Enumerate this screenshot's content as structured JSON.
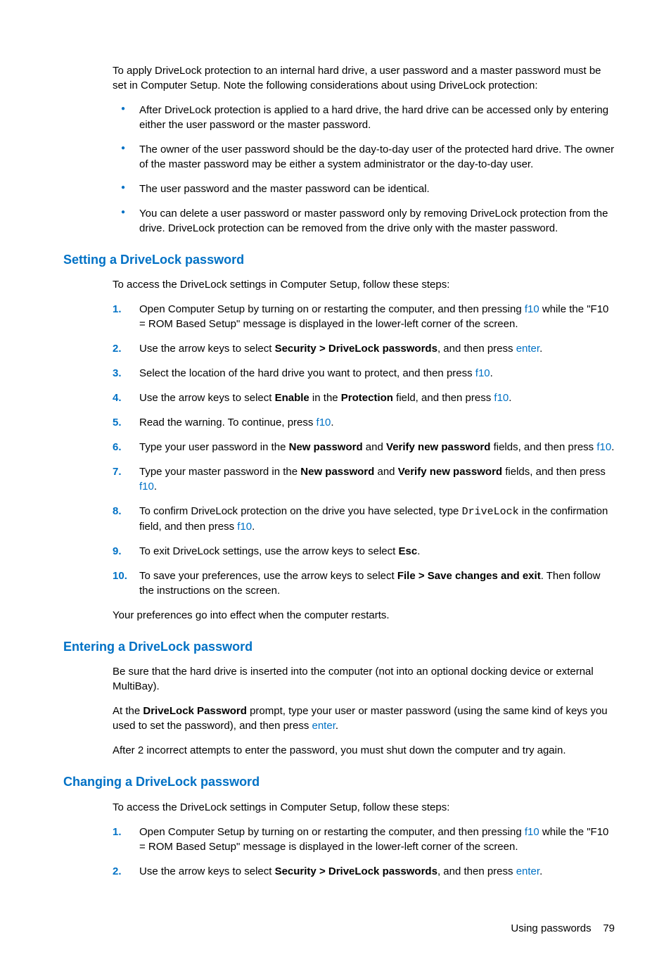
{
  "intro_p1": "To apply DriveLock protection to an internal hard drive, a user password and a master password must be set in Computer Setup. Note the following considerations about using DriveLock protection:",
  "intro_bullets": [
    "After DriveLock protection is applied to a hard drive, the hard drive can be accessed only by entering either the user password or the master password.",
    "The owner of the user password should be the day-to-day user of the protected hard drive. The owner of the master password may be either a system administrator or the day-to-day user.",
    "The user password and the master password can be identical.",
    "You can delete a user password or master password only by removing DriveLock protection from the drive. DriveLock protection can be removed from the drive only with the master password."
  ],
  "h_setting": "Setting a DriveLock password",
  "setting_intro": "To access the DriveLock settings in Computer Setup, follow these steps:",
  "setting_steps": {
    "s1a": "Open Computer Setup by turning on or restarting the computer, and then pressing ",
    "s1_key": "f10",
    "s1b": " while the \"F10 = ROM Based Setup\" message is displayed in the lower-left corner of the screen.",
    "s2a": "Use the arrow keys to select ",
    "s2_bold": "Security > DriveLock passwords",
    "s2b": ", and then press ",
    "s2_key": "enter",
    "s2c": ".",
    "s3a": "Select the location of the hard drive you want to protect, and then press ",
    "s3_key": "f10",
    "s3b": ".",
    "s4a": "Use the arrow keys to select ",
    "s4_bold1": "Enable",
    "s4b": " in the ",
    "s4_bold2": "Protection",
    "s4c": " field, and then press ",
    "s4_key": "f10",
    "s4d": ".",
    "s5a": "Read the warning. To continue, press ",
    "s5_key": "f10",
    "s5b": ".",
    "s6a": "Type your user password in the ",
    "s6_bold1": "New password",
    "s6b": " and ",
    "s6_bold2": "Verify new password",
    "s6c": " fields, and then press ",
    "s6_key": "f10",
    "s6d": ".",
    "s7a": "Type your master password in the ",
    "s7_bold1": "New password",
    "s7b": " and ",
    "s7_bold2": "Verify new password",
    "s7c": " fields, and then press ",
    "s7_key": "f10",
    "s7d": ".",
    "s8a": "To confirm DriveLock protection on the drive you have selected, type ",
    "s8_mono": "DriveLock",
    "s8b": " in the confirmation field, and then press ",
    "s8_key": "f10",
    "s8c": ".",
    "s9a": "To exit DriveLock settings, use the arrow keys to select ",
    "s9_bold": "Esc",
    "s9b": ".",
    "s10a": "To save your preferences, use the arrow keys to select ",
    "s10_bold": "File > Save changes and exit",
    "s10b": ". Then follow the instructions on the screen."
  },
  "setting_after": "Your preferences go into effect when the computer restarts.",
  "h_entering": "Entering a DriveLock password",
  "entering_p1": "Be sure that the hard drive is inserted into the computer (not into an optional docking device or external MultiBay).",
  "entering_p2a": "At the ",
  "entering_p2_bold": "DriveLock Password",
  "entering_p2b": " prompt, type your user or master password (using the same kind of keys you used to set the password), and then press ",
  "entering_p2_key": "enter",
  "entering_p2c": ".",
  "entering_p3": "After 2 incorrect attempts to enter the password, you must shut down the computer and try again.",
  "h_changing": "Changing a DriveLock password",
  "changing_intro": "To access the DriveLock settings in Computer Setup, follow these steps:",
  "changing_steps": {
    "s1a": "Open Computer Setup by turning on or restarting the computer, and then pressing ",
    "s1_key": "f10",
    "s1b": " while the \"F10 = ROM Based Setup\" message is displayed in the lower-left corner of the screen.",
    "s2a": "Use the arrow keys to select ",
    "s2_bold": "Security > DriveLock passwords",
    "s2b": ", and then press ",
    "s2_key": "enter",
    "s2c": "."
  },
  "footer_section": "Using passwords",
  "footer_page": "79"
}
